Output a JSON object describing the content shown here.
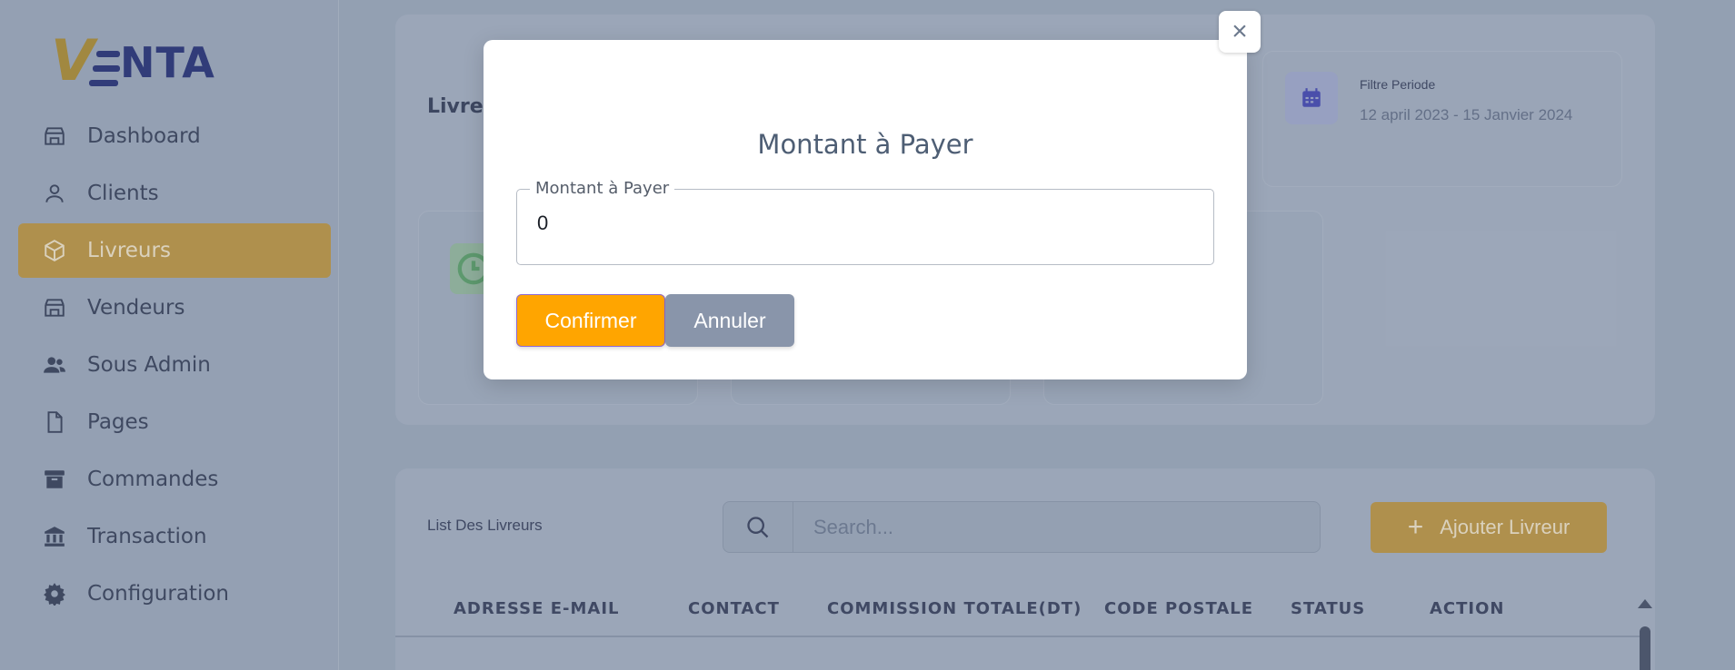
{
  "logo": {
    "letter_v": "V",
    "text": "NTA"
  },
  "sidebar": {
    "items": [
      {
        "label": "Dashboard",
        "icon": "store-icon"
      },
      {
        "label": "Clients",
        "icon": "user-icon"
      },
      {
        "label": "Livreurs",
        "icon": "box-icon",
        "active": true
      },
      {
        "label": "Vendeurs",
        "icon": "store-icon"
      },
      {
        "label": "Sous Admin",
        "icon": "users-icon"
      },
      {
        "label": "Pages",
        "icon": "file-icon"
      },
      {
        "label": "Commandes",
        "icon": "archive-icon"
      },
      {
        "label": "Transaction",
        "icon": "bank-icon"
      },
      {
        "label": "Configuration",
        "icon": "gear-icon"
      }
    ]
  },
  "main": {
    "card_title": "Livreu",
    "filter": {
      "label": "Filtre Periode",
      "value": "12 april 2023 - 15 Janvier 2024"
    },
    "list_label": "List Des Livreurs",
    "search": {
      "placeholder": "Search..."
    },
    "add_button": "Ajouter Livreur",
    "table_headers": [
      "ADRESSE E-MAIL",
      "CONTACT",
      "COMMISSION TOTALE(DT)",
      "CODE POSTALE",
      "STATUS",
      "ACTION"
    ]
  },
  "modal": {
    "title": "Montant à Payer",
    "field_label": "Montant à Payer",
    "field_value": "0",
    "confirm_label": "Confirmer",
    "cancel_label": "Annuler",
    "close_label": "×"
  },
  "colors": {
    "gold": "#b8954a",
    "orange": "#ffa500",
    "navy": "#2f3a7a",
    "grey_button": "#8995aa"
  }
}
